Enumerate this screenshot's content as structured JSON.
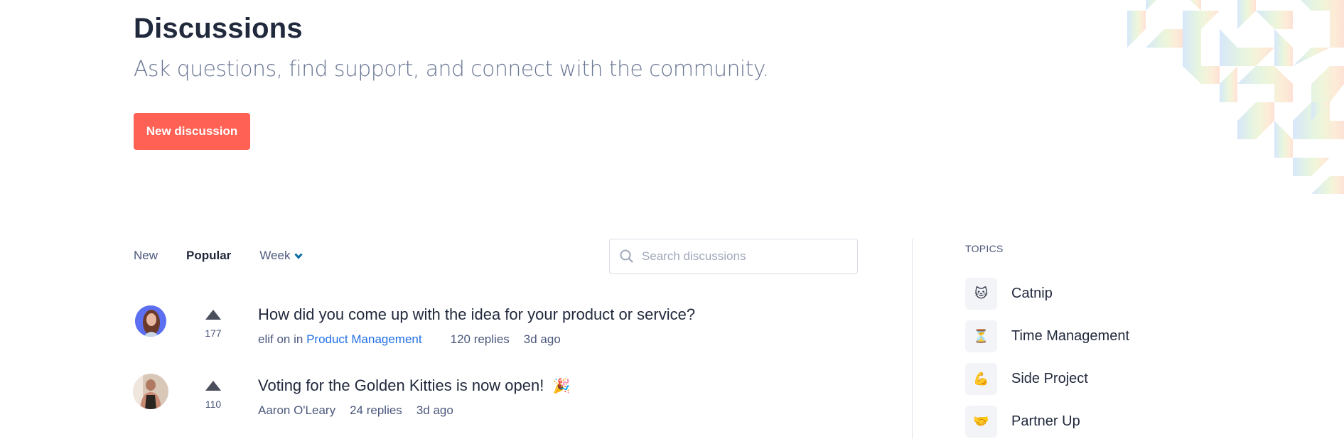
{
  "header": {
    "title": "Discussions",
    "subtitle": "Ask questions, find support, and connect with the community.",
    "new_button_label": "New discussion"
  },
  "colors": {
    "accent": "#ff6154",
    "text_dark": "#21293c",
    "text_muted": "#4b587c",
    "link": "#1f6fe5",
    "chevron": "#0a6ea6"
  },
  "filters": {
    "tabs": [
      {
        "label": "New",
        "active": false
      },
      {
        "label": "Popular",
        "active": true
      }
    ],
    "period": {
      "label": "Week",
      "icon": "chevron-down-icon"
    }
  },
  "search": {
    "icon": "search-icon",
    "placeholder": "Search discussions",
    "value": ""
  },
  "discussions": [
    {
      "title": "How did you come up with the idea for your product or service?",
      "votes": "177",
      "author_prefix": "elif on in",
      "topic_link": "Product Management",
      "replies": "120 replies",
      "age": "3d ago",
      "emoji": ""
    },
    {
      "title": "Voting for the Golden Kitties is now open!",
      "votes": "110",
      "author_prefix": "Aaron O'Leary",
      "topic_link": "",
      "replies": "24 replies",
      "age": "3d ago",
      "emoji": "🎉"
    }
  ],
  "sidebar": {
    "heading": "TOPICS",
    "topics": [
      {
        "label": "Catnip",
        "emoji": "🐱",
        "icon": "cat-icon"
      },
      {
        "label": "Time Management",
        "emoji": "⏳",
        "icon": "hourglass-icon"
      },
      {
        "label": "Side Project",
        "emoji": "💪",
        "icon": "flexed-biceps-icon"
      },
      {
        "label": "Partner Up",
        "emoji": "🤝",
        "icon": "handshake-icon"
      }
    ]
  }
}
